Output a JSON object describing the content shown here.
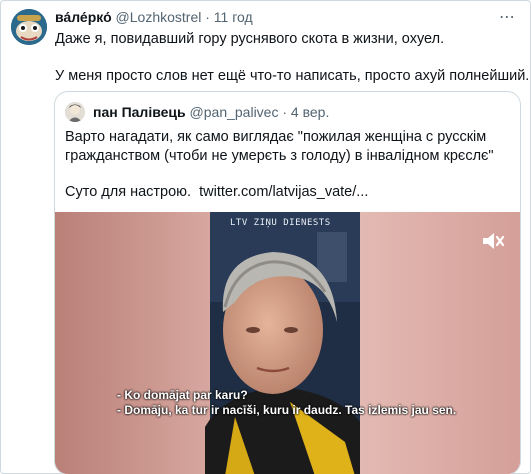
{
  "tweet": {
    "author": {
      "name": "ва́ле́рко́",
      "handle": "@Lozhkostrel",
      "separator": "·",
      "time": "11 год"
    },
    "lines": [
      "Даже я, повидавший гору руснявого скота в жизни, охуел.",
      "У меня просто слов нет ещё что-то написать, просто ахуй полнейший."
    ],
    "more_icon": "⋯"
  },
  "quote": {
    "author": {
      "name": "пан Палівець",
      "handle": "@pan_palivec",
      "separator": "·",
      "time": "4 вер."
    },
    "lines": [
      "Варто нагадати, як само виглядає \"пожилая женщіна с русскім",
      "гражданством (чтоби не умерєть з голоду) в інвалідном крєслє\""
    ],
    "footer_text": "Суто для настрою.",
    "link": "twitter.com/latvijas_vate/...",
    "video": {
      "logo": "LTV ZIŅU DIENESTS",
      "subtitles": [
        "- Ko domājat par karu?",
        "- Domāju, ka tur ir nacīši, kuru ir daudz. Tas izlemis jau sen."
      ],
      "icons": [
        "mute-icon"
      ]
    }
  },
  "colors": {
    "secondary_text": "#536471",
    "border": "#cfd9de",
    "video_background": "#d8a7a0"
  }
}
